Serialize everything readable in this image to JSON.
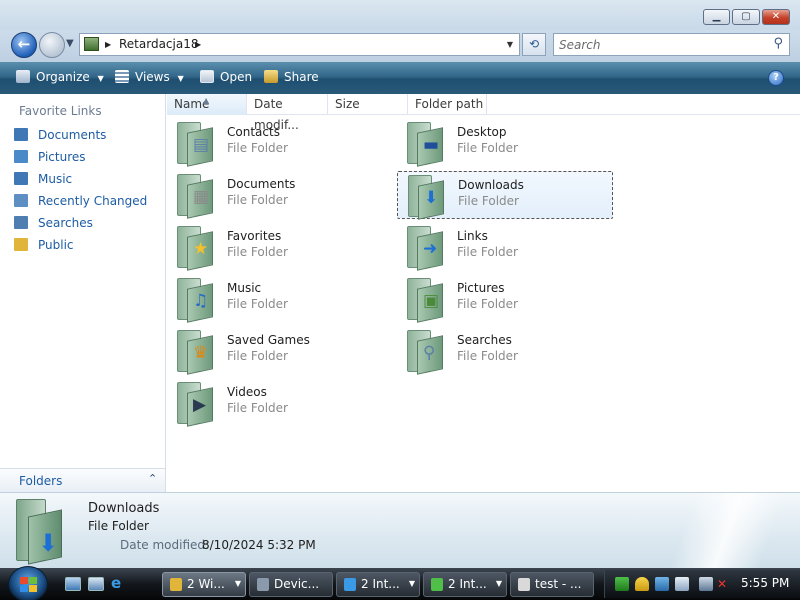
{
  "window": {
    "address": {
      "segment": "Retardacja18"
    },
    "search": {
      "placeholder": "Search"
    }
  },
  "toolbar": {
    "organize": "Organize",
    "views": "Views",
    "open": "Open",
    "share": "Share"
  },
  "nav": {
    "heading": "Favorite Links",
    "items": [
      {
        "label": "Documents",
        "icon": "documents-icon",
        "color": "#3f78b5"
      },
      {
        "label": "Pictures",
        "icon": "pictures-icon",
        "color": "#4a8ac8"
      },
      {
        "label": "Music",
        "icon": "music-icon",
        "color": "#3f78b5"
      },
      {
        "label": "Recently Changed",
        "icon": "recently-changed-icon",
        "color": "#5d8fc2"
      },
      {
        "label": "Searches",
        "icon": "searches-icon",
        "color": "#4f7fb0"
      },
      {
        "label": "Public",
        "icon": "public-folder-icon",
        "color": "#e0b53a"
      }
    ],
    "folders": "Folders"
  },
  "columns": {
    "name": "Name",
    "date": "Date modif...",
    "size": "Size",
    "path": "Folder path"
  },
  "items": [
    {
      "name": "Contacts",
      "type": "File Folder",
      "icon": "contacts-folder-icon"
    },
    {
      "name": "Desktop",
      "type": "File Folder",
      "icon": "desktop-folder-icon"
    },
    {
      "name": "Documents",
      "type": "File Folder",
      "icon": "documents-folder-icon"
    },
    {
      "name": "Downloads",
      "type": "File Folder",
      "icon": "downloads-folder-icon",
      "selected": true
    },
    {
      "name": "Favorites",
      "type": "File Folder",
      "icon": "favorites-folder-icon"
    },
    {
      "name": "Links",
      "type": "File Folder",
      "icon": "links-folder-icon"
    },
    {
      "name": "Music",
      "type": "File Folder",
      "icon": "music-folder-icon"
    },
    {
      "name": "Pictures",
      "type": "File Folder",
      "icon": "pictures-folder-icon"
    },
    {
      "name": "Saved Games",
      "type": "File Folder",
      "icon": "saved-games-folder-icon"
    },
    {
      "name": "Searches",
      "type": "File Folder",
      "icon": "searches-folder-icon"
    },
    {
      "name": "Videos",
      "type": "File Folder",
      "icon": "videos-folder-icon"
    }
  ],
  "details": {
    "name": "Downloads",
    "type": "File Folder",
    "date_label": "Date modified:",
    "date_value": "8/10/2024 5:32 PM"
  },
  "taskbar": {
    "tasks": [
      {
        "label": "2 Wi...",
        "active": true
      },
      {
        "label": "Devic..."
      },
      {
        "label": "2 Int..."
      },
      {
        "label": "2 Int..."
      },
      {
        "label": "test - ..."
      }
    ],
    "clock": "5:55 PM"
  }
}
